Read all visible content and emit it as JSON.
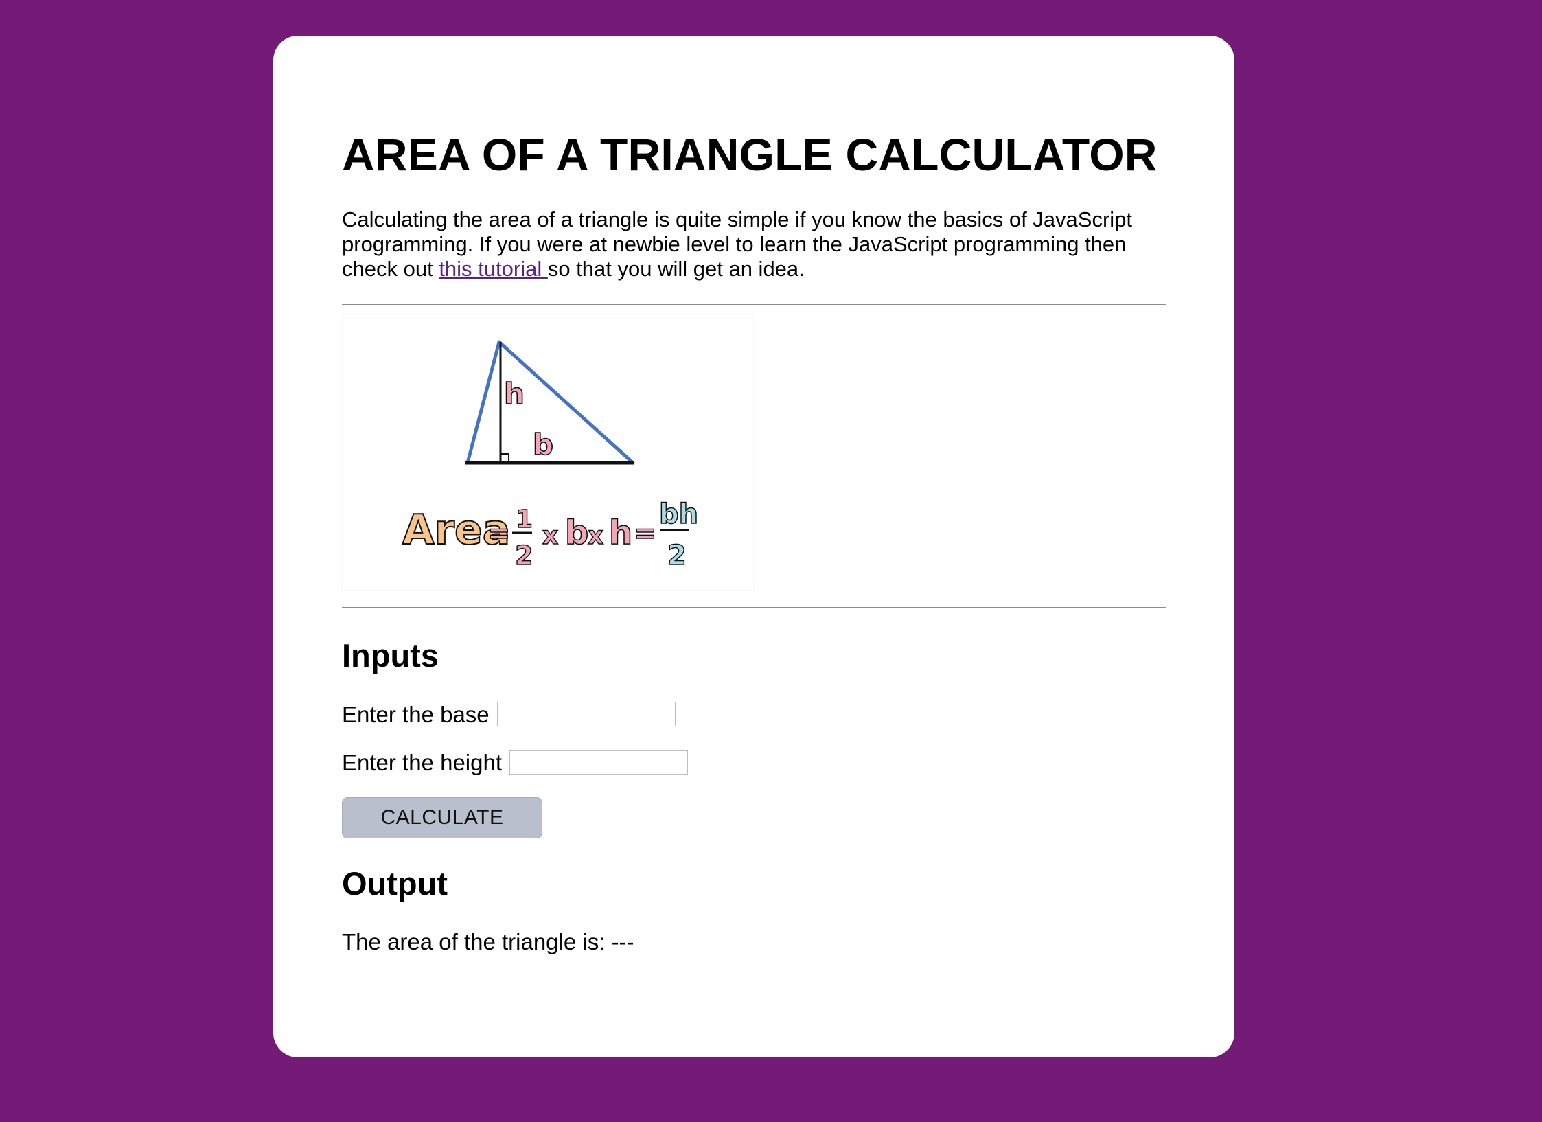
{
  "page": {
    "title": "AREA OF A TRIANGLE CALCULATOR",
    "intro_before_link": "Calculating the area of a triangle is quite simple if you know the basics of JavaScript programming. If you were at newbie level to learn the JavaScript programming then check out ",
    "intro_link_text": "this tutorial ",
    "intro_after_link": "so that you will get an idea."
  },
  "illustration": {
    "height_label": "h",
    "base_label": "b",
    "formula_area": "Area",
    "formula_equals": "=",
    "formula_half_num": "1",
    "formula_half_den": "2",
    "formula_times": "x",
    "formula_b": "b",
    "formula_h": "h",
    "formula_result_num": "bh",
    "formula_result_den": "2",
    "colors": {
      "triangle_stroke": "#4472c4",
      "area_fill": "#f7c48a",
      "pink_fill": "#f4a6b8",
      "teal_fill": "#a9dde3"
    }
  },
  "inputs": {
    "heading": "Inputs",
    "base_label": "Enter the base",
    "base_value": "",
    "height_label": "Enter the height",
    "height_value": "",
    "button_label": "CALCULATE"
  },
  "output": {
    "heading": "Output",
    "result_label": "The area of the triangle is: ",
    "result_value": "---"
  },
  "colors": {
    "background": "#741b78",
    "card": "#ffffff",
    "link": "#5b1f86",
    "button": "#b9bfcc"
  }
}
